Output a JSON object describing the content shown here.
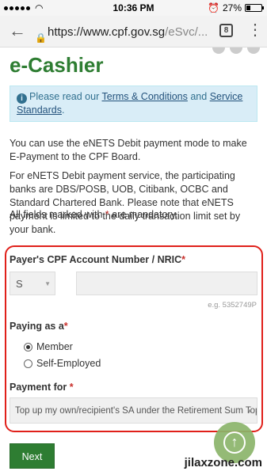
{
  "status_bar": {
    "time": "10:36 PM",
    "battery": "27%",
    "battery_level": 0.27
  },
  "browser": {
    "url_main": "https://www.cpf.gov.sg",
    "url_rest": "/eSvc/...",
    "tab_count": "8"
  },
  "page": {
    "title": "e-Cashier",
    "info": {
      "prefix": "Please read our ",
      "terms_link": "Terms & Conditions",
      "middle": " and ",
      "service_link": "Service Standards",
      "suffix": "."
    },
    "para1": "You can use the eNETS Debit payment mode to make E-Payment to the CPF Board.",
    "para2": "For eNETS Debit payment service, the participating banks are DBS/POSB, UOB, Citibank, OCBC and Standard Chartered Bank. Please note that eNETS payment is limited to the daily transaction limit set by your bank.",
    "mandatory_prefix": "All fields marked with ",
    "mandatory_star": "*",
    "mandatory_suffix": " are mandatory."
  },
  "form": {
    "cpf_label": "Payer's CPF Account Number / NRIC",
    "required_star": "*",
    "prefix_select_value": "S",
    "nric_value": "",
    "nric_hint": "e.g. 5352749P",
    "paying_as_label": "Paying as a",
    "options": {
      "member": "Member",
      "self_employed": "Self-Employed"
    },
    "payment_for_label": "Payment for",
    "payment_for_value": "Top up my own/recipient's SA under the Retirement Sum Topping-Up Scheme",
    "next_label": "Next"
  },
  "watermark": "jilaxzone.com",
  "colors": {
    "brand_green": "#2e7d32",
    "highlight_red": "#e0201a",
    "info_bg": "#d9edf7"
  }
}
